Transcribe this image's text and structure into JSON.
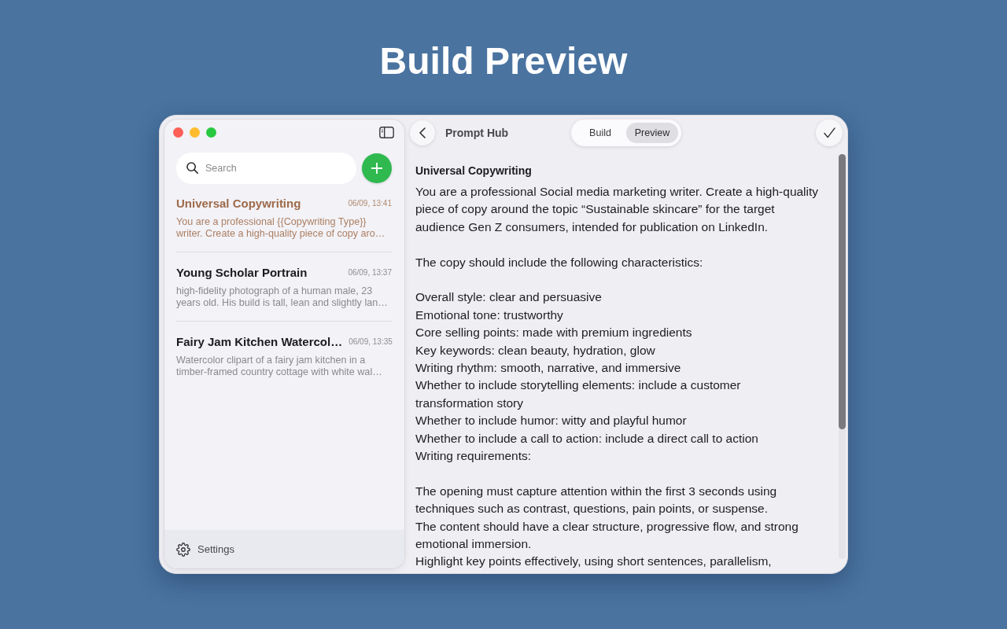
{
  "heading": "Build Preview",
  "sidebar": {
    "search": {
      "placeholder": "Search"
    },
    "prompts": [
      {
        "title": "Universal Copywriting",
        "date": "06/09, 13:41",
        "preview": [
          "You are a professional {{Copywriting Type}}",
          "writer. Create a high-quality piece of copy aro…"
        ],
        "selected": true
      },
      {
        "title": "Young Scholar Portrain",
        "date": "06/09, 13:37",
        "preview": [
          "high-fidelity photograph of a human male, 23",
          "years old. His build is tall, lean and slightly lan…"
        ],
        "selected": false
      },
      {
        "title": "Fairy Jam Kitchen Watercol…",
        "date": "06/09, 13:35",
        "preview": [
          "Watercolor clipart of a fairy jam kitchen in a",
          "timber-framed country cottage with white wal…"
        ],
        "selected": false
      }
    ],
    "footer": {
      "label": "Settings"
    }
  },
  "header": {
    "title": "Prompt Hub",
    "modes": [
      {
        "label": "Build",
        "selected": false
      },
      {
        "label": "Preview",
        "selected": true
      }
    ]
  },
  "document": {
    "title": "Universal Copywriting",
    "blocks": [
      {
        "lines": [
          "You are a professional Social media marketing writer. Create a high-quality piece of copy around the topic “Sustainable skincare” for the target audience Gen Z consumers, intended for publication on LinkedIn."
        ]
      },
      {
        "lines": [
          "The copy should include the following characteristics:"
        ]
      },
      {
        "lines": [
          "Overall style: clear and persuasive",
          "Emotional tone: trustworthy",
          "Core selling points: made with premium ingredients",
          "Key keywords: clean beauty, hydration, glow",
          "Writing rhythm: smooth, narrative, and immersive",
          "Whether to include storytelling elements: include a customer transformation story",
          "Whether to include humor: witty and playful humor",
          "Whether to include a call to action: include a direct call to action",
          "Writing requirements:"
        ]
      },
      {
        "lines": [
          "The opening must capture attention within the first 3 seconds using techniques such as contrast, questions, pain points, or suspense.",
          "The content should have a clear structure, progressive flow, and strong emotional immersion.",
          "Highlight key points effectively, using short sentences, parallelism,"
        ]
      }
    ]
  }
}
